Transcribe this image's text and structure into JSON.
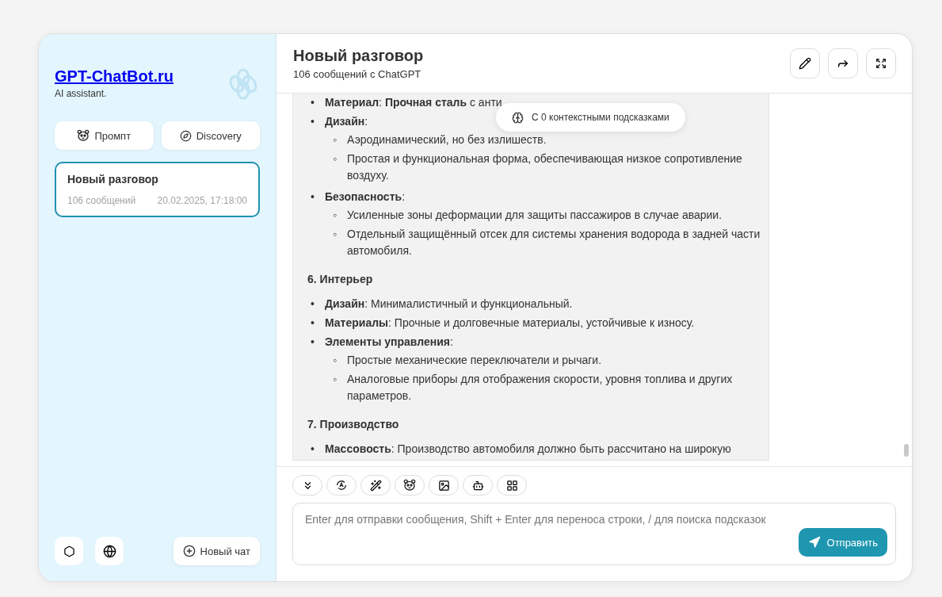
{
  "sidebar": {
    "brand": "GPT-ChatBot.ru",
    "tagline": "AI assistant.",
    "actions": [
      {
        "label": "Промпт",
        "kind": "prompt"
      },
      {
        "label": "Discovery",
        "kind": "discovery"
      }
    ],
    "conversations": [
      {
        "title": "Новый разговор",
        "count": "106 сообщений",
        "date": "20.02.2025, 17:18:00",
        "selected": true
      }
    ],
    "footer": {
      "new_chat": "Новый чат"
    }
  },
  "chat": {
    "title": "Новый разговор",
    "subtitle": "106 сообщений с ChatGPT",
    "hint_badge": "С 0 контекстными подсказками",
    "blocks": [
      {
        "kind": "list",
        "items": [
          {
            "bullet": "•",
            "label": "Материал",
            "text": ": **Прочная сталь** с анти"
          },
          {
            "bullet": "•",
            "label": "Дизайн",
            "text": ":",
            "children": [
              {
                "bullet": "◦",
                "text": "Аэродинамический, но без излишеств."
              },
              {
                "bullet": "◦",
                "text": "Простая и функциональная форма, обеспечивающая низкое сопротивление воздуху."
              }
            ]
          },
          {
            "bullet": "•",
            "label": "Безопасность",
            "text": ":",
            "children": [
              {
                "bullet": "◦",
                "text": "Усиленные зоны деформации для защиты пассажиров в случае аварии."
              },
              {
                "bullet": "◦",
                "text": "Отдельный защищённый отсек для системы хранения водорода в задней части автомобиля."
              }
            ]
          }
        ]
      },
      {
        "kind": "heading",
        "text": "6. Интерьер"
      },
      {
        "kind": "list",
        "items": [
          {
            "bullet": "•",
            "label": "Дизайн",
            "text": ": Минималистичный и функциональный."
          },
          {
            "bullet": "•",
            "label": "Материалы",
            "text": ": Прочные и долговечные материалы, устойчивые к износу."
          },
          {
            "bullet": "•",
            "label": "Элементы управления",
            "text": ":",
            "children": [
              {
                "bullet": "◦",
                "text": "Простые механические переключатели и рычаги."
              },
              {
                "bullet": "◦",
                "text": "Аналоговые приборы для отображения скорости, уровня топлива и других параметров."
              }
            ]
          }
        ]
      },
      {
        "kind": "heading",
        "text": "7. Производство"
      },
      {
        "kind": "list",
        "items": [
          {
            "bullet": "•",
            "label": "Массовость",
            "text": ": Производство автомобиля должно быть рассчитано на широкую"
          }
        ]
      }
    ],
    "input": {
      "placeholder": "Enter для отправки сообщения, Shift + Enter для переноса строки, / для поиска подсказок",
      "send": "Отправить"
    }
  }
}
